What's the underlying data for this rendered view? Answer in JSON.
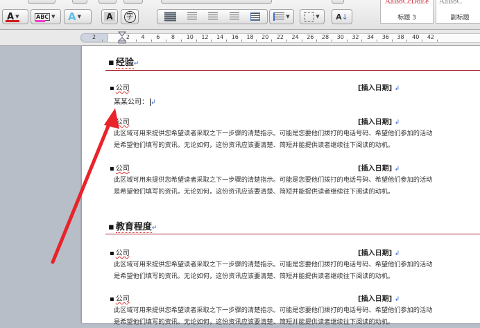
{
  "toolbar": {
    "font_color_label": "A",
    "highlight_label": "ABC",
    "text_effect_label": "A",
    "char_shade_label": "A",
    "enclose_label": "字",
    "sort_label": "A",
    "colors": {
      "font_underline": "#d11a1a",
      "highlight_underline": "#f03cc8"
    }
  },
  "styles": {
    "sample_1": "AaBbCcDdEe",
    "name_1": "标题 3",
    "sample_2": "AaBbC",
    "name_2": "副标题"
  },
  "ruler": {
    "numbers": [
      "2",
      "2",
      "4",
      "6",
      "8",
      "10",
      "12",
      "14",
      "16",
      "18",
      "20",
      "22",
      "24",
      "26",
      "28",
      "30",
      "32",
      "34",
      "36",
      "38",
      "40",
      "42"
    ]
  },
  "document": {
    "section_experience": "经验",
    "section_education": "教育程度",
    "company_label": "公司",
    "date_placeholder": "[插入日期]",
    "typed_line": "某某公司：",
    "paragraph_line1": "此区域可用来提供您希望读者采取之下一步骤的清楚指示。可能是您要他们拨打的电话号码、希望他们参加的活动",
    "paragraph_line2": "是希望他们填写的资讯。无论如何，这份资讯应该要清楚、简短并能提供读者继续往下阅读的动机。",
    "para_mark": "↵",
    "line_mark": "↲",
    "bullet": "▪"
  },
  "annotation": {
    "arrow_color": "#e8232a"
  }
}
